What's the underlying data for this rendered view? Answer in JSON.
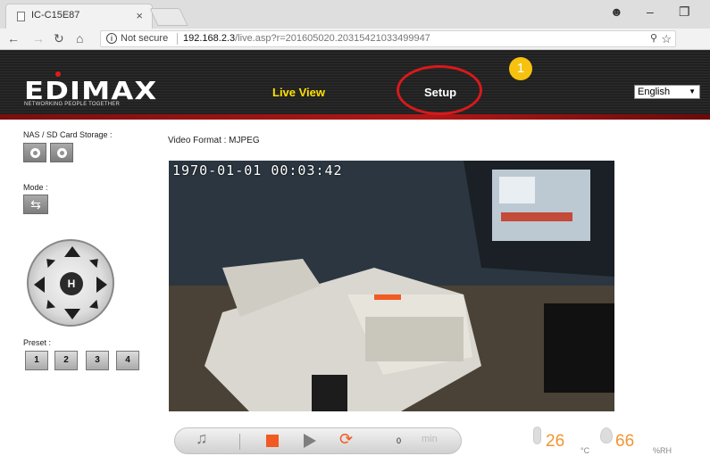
{
  "browser": {
    "tab_title": "IC-C15E87",
    "tab_close": "×",
    "not_secure": "Not secure",
    "url_host": "192.168.2.3",
    "url_path": "/live.asp?r=201605020.20315421033499947"
  },
  "header": {
    "logo": "EDIMAX",
    "tagline": "NETWORKING PEOPLE TOGETHER",
    "nav_live": "Live View",
    "nav_setup": "Setup",
    "badge": "1",
    "language": "English"
  },
  "left_panel": {
    "storage_label": "NAS / SD Card Storage :",
    "mode_label": "Mode :",
    "ptz_home": "H",
    "preset_label": "Preset :",
    "presets": [
      "1",
      "2",
      "3",
      "4"
    ]
  },
  "video": {
    "format_label": "Video Format : MJPEG",
    "timestamp": "1970-01-01 00:03:42"
  },
  "controls": {
    "minutes_value": "0",
    "minutes_label": "min"
  },
  "sensors": {
    "temperature": "26",
    "temperature_unit": "°C",
    "humidity": "66",
    "humidity_unit": "%RH"
  },
  "colors": {
    "accent_orange": "#f15a22",
    "nav_active": "#ffe000",
    "highlight_red": "#d8191b",
    "badge_yellow": "#f6c20f"
  }
}
